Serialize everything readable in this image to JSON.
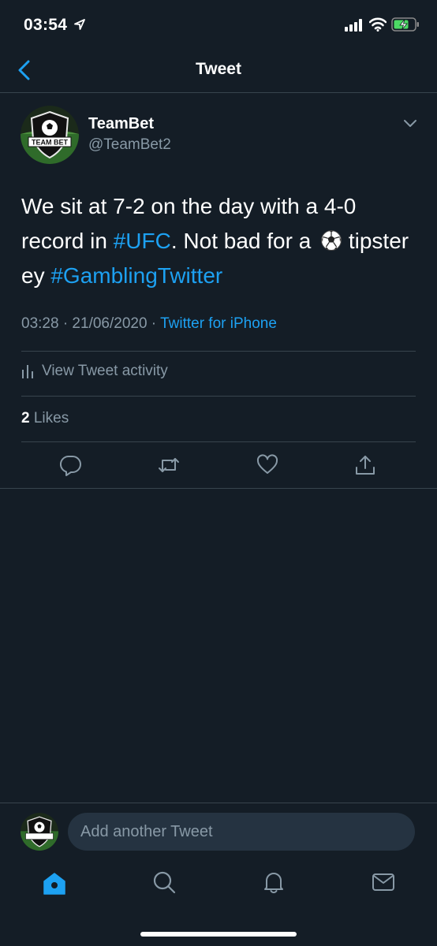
{
  "status_bar": {
    "time": "03:54"
  },
  "nav": {
    "title": "Tweet"
  },
  "tweet": {
    "display_name": "TeamBet",
    "username": "@TeamBet2",
    "avatar_text": "TEAM BET",
    "text_part1": "We sit at 7-2 on the day with a 4-0 record in ",
    "hashtag1": "#UFC",
    "text_part2": ". Not bad for a ",
    "text_part3": " tipster ey ",
    "hashtag2": "#GamblingTwitter",
    "timestamp": "03:28 · 21/06/2020 · ",
    "source": "Twitter for iPhone",
    "activity_label": "View Tweet activity",
    "likes_count": "2",
    "likes_label": " Likes"
  },
  "reply": {
    "placeholder": "Add another Tweet"
  },
  "colors": {
    "background": "#141d26",
    "accent": "#1da1f2",
    "secondary_text": "#8899a6",
    "divider": "#38444d"
  },
  "icons": {
    "back": "chevron-left-icon",
    "caret": "chevron-down-icon",
    "reply": "reply-icon",
    "retweet": "retweet-icon",
    "like": "heart-icon",
    "share": "share-icon",
    "home": "home-icon",
    "search": "search-icon",
    "notifications": "bell-icon",
    "messages": "mail-icon"
  }
}
